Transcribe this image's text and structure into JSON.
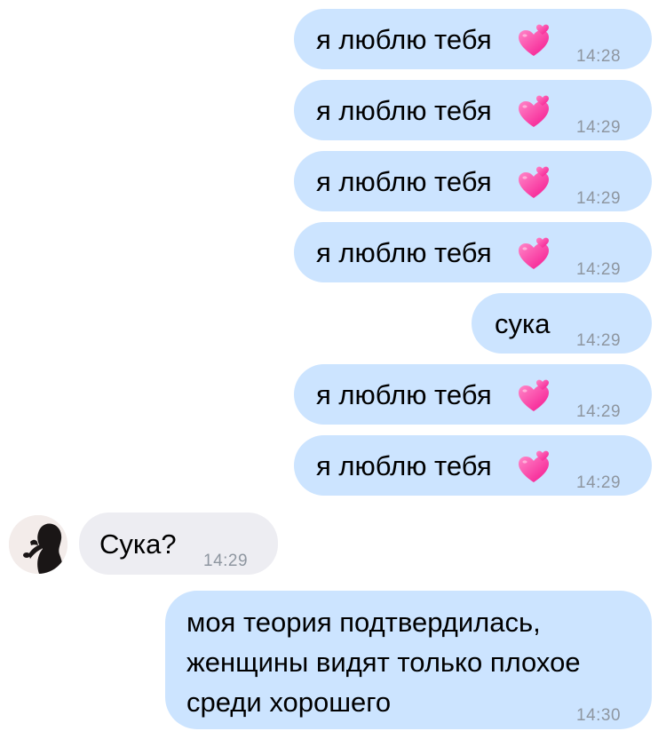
{
  "messages": [
    {
      "text": "я люблю тебя",
      "time": "14:28"
    },
    {
      "text": "я люблю тебя",
      "time": "14:29"
    },
    {
      "text": "я люблю тебя",
      "time": "14:29"
    },
    {
      "text": "я люблю тебя",
      "time": "14:29"
    },
    {
      "text": "сука",
      "time": "14:29"
    },
    {
      "text": "я люблю тебя",
      "time": "14:29"
    },
    {
      "text": "я люблю тебя",
      "time": "14:29"
    },
    {
      "text": "Сука?",
      "time": "14:29"
    },
    {
      "lines": [
        "моя теория подтвердилась,",
        "женщины видят только плохое",
        "среди хорошего"
      ],
      "time": "14:30"
    }
  ],
  "icons": {
    "heart": "two-hearts-icon",
    "avatar": "contact-avatar"
  },
  "colors": {
    "outgoing_bubble": "#cce4ff",
    "incoming_bubble": "#ededf2",
    "timestamp": "#8e96a0",
    "heart": "#ff3aa4"
  }
}
